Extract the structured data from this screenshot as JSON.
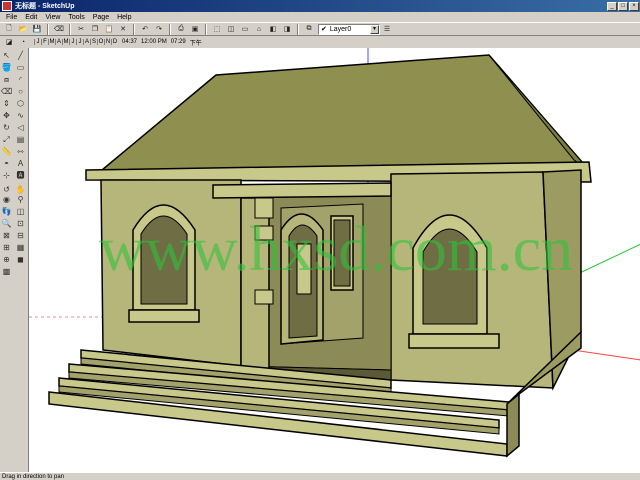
{
  "window": {
    "title": "无标题 - SketchUp",
    "minimize": "_",
    "maximize": "□",
    "close": "×"
  },
  "menu": [
    {
      "label": "File"
    },
    {
      "label": "Edit"
    },
    {
      "label": "View"
    },
    {
      "label": "Tools"
    },
    {
      "label": "Page"
    },
    {
      "label": "Help"
    }
  ],
  "layer": {
    "selected": "Layer0"
  },
  "shadow": {
    "months": [
      "J",
      "F",
      "M",
      "A",
      "M",
      "J",
      "J",
      "A",
      "S",
      "O",
      "N",
      "D"
    ],
    "time_start": "04:37",
    "time_mid": "12:00 PM",
    "time_end": "07:29",
    "end_label": "下午"
  },
  "watermark": {
    "text": "www.hxsd.com.cn"
  },
  "status": {
    "text": "Drag in direction to pan"
  },
  "colors": {
    "wall": "#b7b67a",
    "roof": "#8f9050",
    "titlebar": "#0a246a",
    "watermark": "#2ec23a"
  }
}
